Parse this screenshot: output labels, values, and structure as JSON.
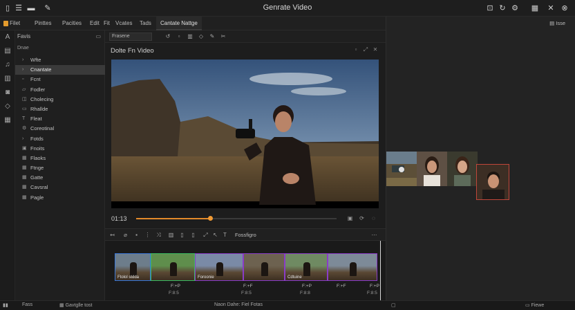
{
  "window": {
    "title": "Genrate Video"
  },
  "titlebar_icons": [
    "sidebar-icon",
    "menu-icon",
    "folder-icon",
    "share-icon"
  ],
  "titlebar_right_icons": [
    "export-icon",
    "refresh-icon",
    "settings-icon",
    "grid-icon",
    "tools-icon",
    "close-icon"
  ],
  "menu": {
    "items": [
      "Filet",
      "Pinttes",
      "Pacities",
      "Edit",
      "Fit",
      "Vcates",
      "Tads"
    ],
    "active_tab": "Cantate Nattge"
  },
  "left_panel": {
    "header": "Favis",
    "subheader": "Dnae",
    "items": [
      {
        "label": "Wfte",
        "icon": "chevron-right-icon",
        "selected": false
      },
      {
        "label": "Cnantate",
        "icon": "chevron-right-icon",
        "selected": true
      },
      {
        "label": "Fcnt",
        "icon": "file-icon",
        "selected": false
      },
      {
        "label": "Fodler",
        "icon": "folder-icon",
        "selected": false
      },
      {
        "label": "Cholecing",
        "icon": "layers-icon",
        "selected": false
      },
      {
        "label": "Rhallde",
        "icon": "clip-icon",
        "selected": false
      },
      {
        "label": "Fleat",
        "icon": "text-icon",
        "selected": false
      },
      {
        "label": "Coreotinal",
        "icon": "settings-icon",
        "selected": false
      },
      {
        "label": "Fotds",
        "icon": "chevron-right-icon",
        "selected": false
      },
      {
        "label": "Fnoits",
        "icon": "image-icon",
        "selected": false
      },
      {
        "label": "Flaoks",
        "icon": "grid-icon",
        "selected": false
      },
      {
        "label": "Ftnge",
        "icon": "grid-icon",
        "selected": false
      },
      {
        "label": "Gatte",
        "icon": "grid-icon",
        "selected": false
      },
      {
        "label": "Cavsral",
        "icon": "grid-icon",
        "selected": false
      },
      {
        "label": "Pagle",
        "icon": "grid-icon",
        "selected": false
      }
    ]
  },
  "toolbar": {
    "select_value": "Frasene"
  },
  "preview": {
    "title": "Dolte Fn Video",
    "timecode": "01:13",
    "progress": 0.37
  },
  "timeline": {
    "label": "Fossfigro",
    "clips": [
      {
        "label": "Ftolol stdda",
        "border": "#3a78d8"
      },
      {
        "label": "",
        "border": "#3cbc62"
      },
      {
        "label": "Foroonie",
        "border": "#8a3cc8"
      },
      {
        "label": "",
        "border": "#8a3cc8"
      },
      {
        "label": "Cdtuine",
        "border": "#8a3cc8"
      },
      {
        "label": "",
        "border": "#8a3cc8"
      }
    ],
    "timecodes": [
      "F:+P",
      "F:+F",
      "F:+P",
      "F:+F",
      "F:+P"
    ],
    "sub_timecodes": [
      "F:8:5",
      "F:8:5",
      "F:8:8",
      "F:8:5"
    ]
  },
  "right_panel": {
    "header": "Isse"
  },
  "status": {
    "left": "Fass",
    "mid": "Gavtglle tost",
    "center": "Naon Dahe: Fiel Fotas",
    "right": "Fiewe"
  }
}
